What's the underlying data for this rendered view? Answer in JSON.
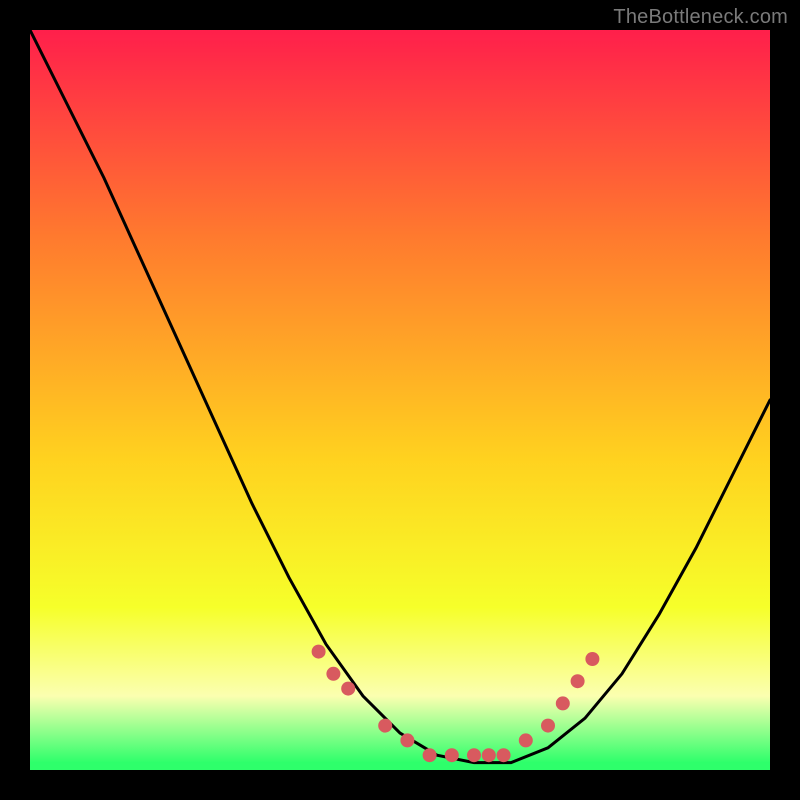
{
  "attribution": "TheBottleneck.com",
  "colors": {
    "top": "#ff1f4b",
    "upper_mid": "#ff7a2e",
    "mid": "#ffd21f",
    "lower_mid": "#f6ff2a",
    "pale_yellow": "#fbffb0",
    "bright_green": "#2eff6b",
    "curve": "#000000",
    "marker": "#d85a5f",
    "background": "#000000"
  },
  "chart_data": {
    "type": "line",
    "title": "",
    "xlabel": "",
    "ylabel": "",
    "x": [
      0.0,
      0.05,
      0.1,
      0.15,
      0.2,
      0.25,
      0.3,
      0.35,
      0.4,
      0.45,
      0.5,
      0.55,
      0.6,
      0.65,
      0.7,
      0.75,
      0.8,
      0.85,
      0.9,
      0.95,
      1.0
    ],
    "values": [
      1.0,
      0.9,
      0.8,
      0.69,
      0.58,
      0.47,
      0.36,
      0.26,
      0.17,
      0.1,
      0.05,
      0.02,
      0.01,
      0.01,
      0.03,
      0.07,
      0.13,
      0.21,
      0.3,
      0.4,
      0.5
    ],
    "xlim": [
      0,
      1
    ],
    "ylim": [
      0,
      1
    ],
    "markers": {
      "x": [
        0.39,
        0.41,
        0.43,
        0.48,
        0.51,
        0.54,
        0.57,
        0.6,
        0.62,
        0.64,
        0.67,
        0.7,
        0.72,
        0.74,
        0.76
      ],
      "y": [
        0.16,
        0.13,
        0.11,
        0.06,
        0.04,
        0.02,
        0.02,
        0.02,
        0.02,
        0.02,
        0.04,
        0.06,
        0.09,
        0.12,
        0.15
      ]
    }
  }
}
